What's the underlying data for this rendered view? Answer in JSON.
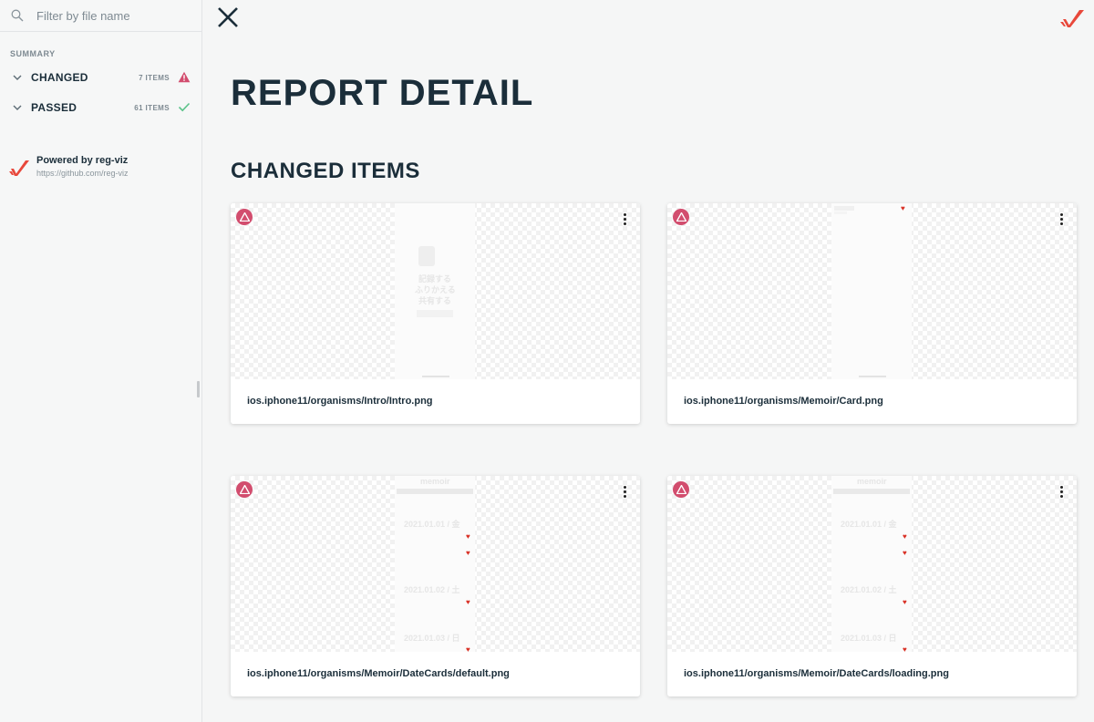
{
  "search": {
    "placeholder": "Filter by file name"
  },
  "summary": {
    "title": "SUMMARY",
    "changed": {
      "label": "CHANGED",
      "count": "7 ITEMS",
      "status_color": "#d24d6e"
    },
    "passed": {
      "label": "PASSED",
      "count": "61 ITEMS",
      "status_color": "#5cc38a"
    }
  },
  "powered": {
    "title": "Powered by reg-viz",
    "url": "https://github.com/reg-viz"
  },
  "page": {
    "title": "REPORT DETAIL",
    "section": "CHANGED ITEMS"
  },
  "cards": [
    {
      "name": "ios.iphone11/organisms/Intro/Intro.png",
      "ghost": [
        "記録する",
        "ふりかえる",
        "共有する"
      ]
    },
    {
      "name": "ios.iphone11/organisms/Memoir/Card.png"
    },
    {
      "name": "ios.iphone11/organisms/Memoir/DateCards/default.png",
      "ghost": [
        "memoir",
        "2021.01.01 / 金",
        "2021.01.02 / 土",
        "2021.01.03 / 日"
      ]
    },
    {
      "name": "ios.iphone11/organisms/Memoir/DateCards/loading.png",
      "ghost": [
        "memoir",
        "2021.01.01 / 金",
        "2021.01.02 / 土",
        "2021.01.03 / 日"
      ]
    }
  ],
  "icons": {
    "search": "search-icon",
    "close": "close-icon",
    "logo": "reg-viz-logo",
    "warning": "warning-icon",
    "check": "check-icon",
    "chevron": "chevron-down-icon",
    "more": "more-vert-icon"
  },
  "colors": {
    "accent": "#e8483b",
    "warning": "#d24d6e",
    "success": "#5cc38a",
    "text": "#1b2e3a"
  }
}
